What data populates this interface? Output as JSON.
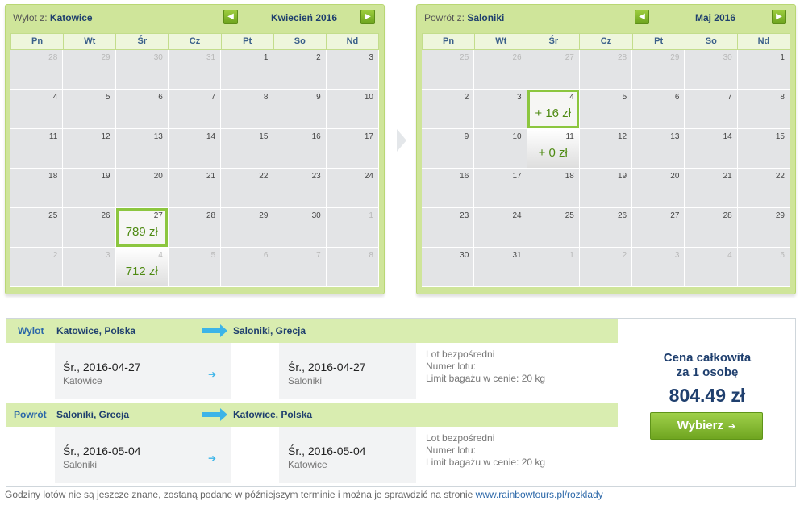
{
  "departure_calendar": {
    "label": "Wylot z:",
    "city": "Katowice",
    "month": "Kwiecień 2016",
    "prev": "◀",
    "next": "▶",
    "weekdays": [
      "Pn",
      "Wt",
      "Śr",
      "Cz",
      "Pt",
      "So",
      "Nd"
    ],
    "weeks": [
      [
        {
          "d": "28",
          "o": true
        },
        {
          "d": "29",
          "o": true
        },
        {
          "d": "30",
          "o": true
        },
        {
          "d": "31",
          "o": true
        },
        {
          "d": "1"
        },
        {
          "d": "2"
        },
        {
          "d": "3"
        }
      ],
      [
        {
          "d": "4"
        },
        {
          "d": "5"
        },
        {
          "d": "6"
        },
        {
          "d": "7"
        },
        {
          "d": "8"
        },
        {
          "d": "9"
        },
        {
          "d": "10"
        }
      ],
      [
        {
          "d": "11"
        },
        {
          "d": "12"
        },
        {
          "d": "13"
        },
        {
          "d": "14"
        },
        {
          "d": "15"
        },
        {
          "d": "16"
        },
        {
          "d": "17"
        }
      ],
      [
        {
          "d": "18"
        },
        {
          "d": "19"
        },
        {
          "d": "20"
        },
        {
          "d": "21"
        },
        {
          "d": "22"
        },
        {
          "d": "23"
        },
        {
          "d": "24"
        }
      ],
      [
        {
          "d": "25"
        },
        {
          "d": "26"
        },
        {
          "d": "27",
          "price": "789 zł",
          "sel": true
        },
        {
          "d": "28"
        },
        {
          "d": "29"
        },
        {
          "d": "30"
        },
        {
          "d": "1",
          "o": true
        }
      ],
      [
        {
          "d": "2",
          "o": true
        },
        {
          "d": "3",
          "o": true
        },
        {
          "d": "4",
          "o": true,
          "price": "712 zł",
          "avail": true
        },
        {
          "d": "5",
          "o": true
        },
        {
          "d": "6",
          "o": true
        },
        {
          "d": "7",
          "o": true
        },
        {
          "d": "8",
          "o": true
        }
      ]
    ]
  },
  "return_calendar": {
    "label": "Powrót z:",
    "city": "Saloniki",
    "month": "Maj 2016",
    "prev": "◀",
    "next": "▶",
    "weekdays": [
      "Pn",
      "Wt",
      "Śr",
      "Cz",
      "Pt",
      "So",
      "Nd"
    ],
    "weeks": [
      [
        {
          "d": "25",
          "o": true
        },
        {
          "d": "26",
          "o": true
        },
        {
          "d": "27",
          "o": true
        },
        {
          "d": "28",
          "o": true
        },
        {
          "d": "29",
          "o": true
        },
        {
          "d": "30",
          "o": true
        },
        {
          "d": "1"
        }
      ],
      [
        {
          "d": "2"
        },
        {
          "d": "3"
        },
        {
          "d": "4",
          "price": "+ 16 zł",
          "sel": true
        },
        {
          "d": "5"
        },
        {
          "d": "6"
        },
        {
          "d": "7"
        },
        {
          "d": "8"
        }
      ],
      [
        {
          "d": "9"
        },
        {
          "d": "10"
        },
        {
          "d": "11",
          "price": "+ 0 zł",
          "avail": true
        },
        {
          "d": "12"
        },
        {
          "d": "13"
        },
        {
          "d": "14"
        },
        {
          "d": "15"
        }
      ],
      [
        {
          "d": "16"
        },
        {
          "d": "17"
        },
        {
          "d": "18"
        },
        {
          "d": "19"
        },
        {
          "d": "20"
        },
        {
          "d": "21"
        },
        {
          "d": "22"
        }
      ],
      [
        {
          "d": "23"
        },
        {
          "d": "24"
        },
        {
          "d": "25"
        },
        {
          "d": "26"
        },
        {
          "d": "27"
        },
        {
          "d": "28"
        },
        {
          "d": "29"
        }
      ],
      [
        {
          "d": "30"
        },
        {
          "d": "31"
        },
        {
          "d": "1",
          "o": true
        },
        {
          "d": "2",
          "o": true
        },
        {
          "d": "3",
          "o": true
        },
        {
          "d": "4",
          "o": true
        },
        {
          "d": "5",
          "o": true
        }
      ]
    ]
  },
  "outbound": {
    "label": "Wylot",
    "from": "Katowice, Polska",
    "to": "Saloniki, Grecja",
    "dep_date": "Śr., 2016-04-27",
    "dep_city": "Katowice",
    "arr_date": "Śr., 2016-04-27",
    "arr_city": "Saloniki",
    "arrow": "➔",
    "info1": "Lot bezpośredni",
    "info2": "Numer lotu:",
    "info3": "Limit bagażu w cenie: 20 kg"
  },
  "inbound": {
    "label": "Powrót",
    "from": "Saloniki, Grecja",
    "to": "Katowice, Polska",
    "dep_date": "Śr., 2016-05-04",
    "dep_city": "Saloniki",
    "arr_date": "Śr., 2016-05-04",
    "arr_city": "Katowice",
    "arrow": "➔",
    "info1": "Lot bezpośredni",
    "info2": "Numer lotu:",
    "info3": "Limit bagażu w cenie: 20 kg"
  },
  "total": {
    "line1": "Cena całkowita",
    "line2": "za 1 osobę",
    "price": "804.49 zł",
    "button": "Wybierz",
    "button_arrow": "➔"
  },
  "footer": {
    "text": "Godziny lotów nie są jeszcze znane, zostaną podane w późniejszym terminie i można je sprawdzić na stronie ",
    "link": "www.rainbowtours.pl/rozklady"
  },
  "colors": {
    "panel": "#cfe59a",
    "accent_green": "#8cc63f",
    "price_green": "#4e8a12",
    "navy": "#1f3f6e",
    "arrow_blue": "#3cb4e8"
  }
}
